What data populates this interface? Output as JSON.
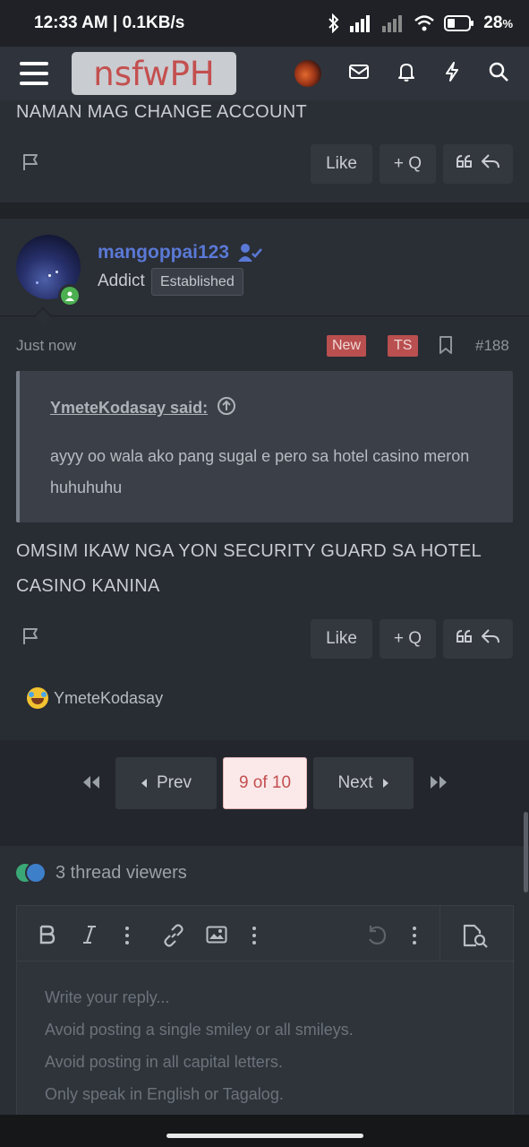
{
  "status": {
    "time": "12:33 AM | 0.1KB/s",
    "battery": "28"
  },
  "nav": {
    "logo": "nsfwPH"
  },
  "prev_post": {
    "text": "NAMAN MAG CHANGE ACCOUNT",
    "like": "Like",
    "quote": "+ Q"
  },
  "post": {
    "username": "mangoppai123",
    "user_title": "Addict",
    "badge": "Established",
    "time": "Just now",
    "tag_new": "New",
    "tag_ts": "TS",
    "number": "#188",
    "quote_author": "YmeteKodasay said:",
    "quote_body": "ayyy oo wala ako pang sugal e pero sa hotel casino meron huhuhuhu",
    "message": "OMSIM IKAW NGA YON SECURITY GUARD SA HOTEL CASINO KANINA",
    "like": "Like",
    "quote": "+ Q",
    "reaction_user": "YmeteKodasay"
  },
  "pagination": {
    "prev": "Prev",
    "current": "9 of 10",
    "next": "Next"
  },
  "viewers": {
    "label": "3 thread viewers"
  },
  "editor": {
    "placeholder_lines": [
      "Write your reply...",
      "Avoid posting a single smiley or all smileys.",
      "Avoid posting in all capital letters.",
      "Only speak in English or Tagalog."
    ]
  },
  "colors": {
    "accent": "#c44f4f",
    "username": "#5a79d6",
    "online": "#4caf50"
  }
}
